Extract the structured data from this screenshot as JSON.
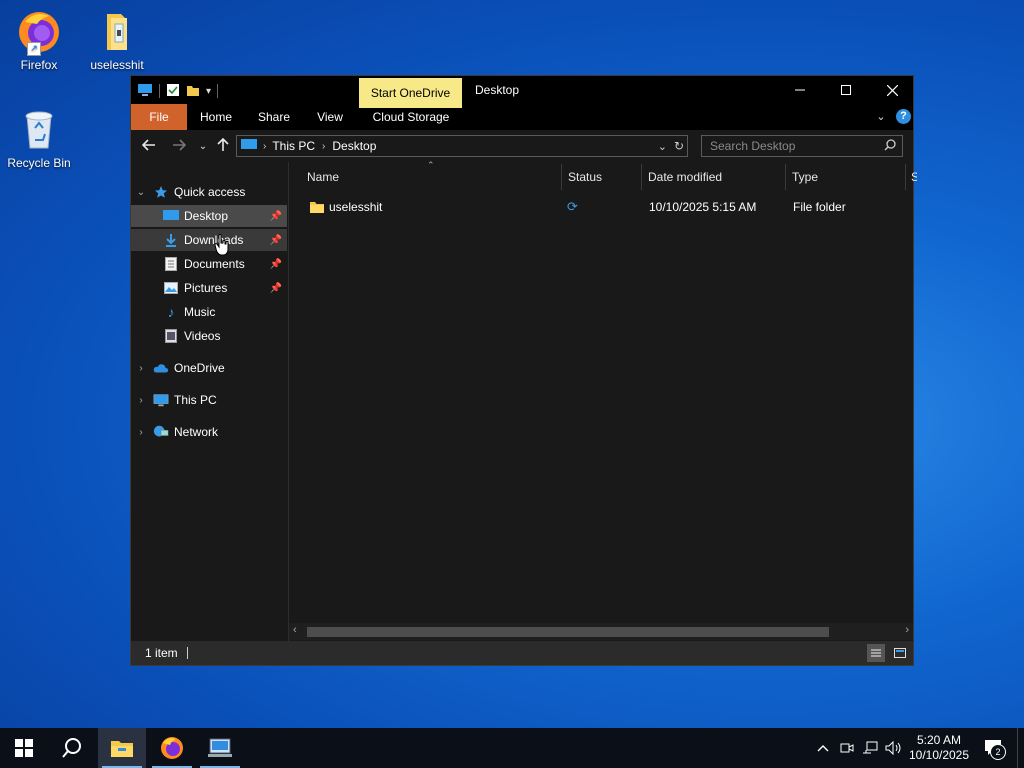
{
  "desktop": {
    "icons": [
      {
        "label": "Firefox",
        "icon": "firefox-icon"
      },
      {
        "label": "uselesshit",
        "icon": "folder-zip-icon"
      },
      {
        "label": "Recycle Bin",
        "icon": "recycle-bin-icon"
      }
    ]
  },
  "window": {
    "title": "Desktop",
    "contextual_tab": "Start OneDrive",
    "ribbon_tabs": [
      "File",
      "Home",
      "Share",
      "View",
      "Cloud Storage"
    ],
    "breadcrumb": [
      "This PC",
      "Desktop"
    ],
    "search_placeholder": "Search Desktop",
    "nav": {
      "quick_access": "Quick access",
      "quick_items": [
        {
          "label": "Desktop",
          "icon": "desktop-icon",
          "pinned": true,
          "selected": true
        },
        {
          "label": "Downloads",
          "icon": "downloads-icon",
          "pinned": true,
          "hover": true
        },
        {
          "label": "Documents",
          "icon": "documents-icon",
          "pinned": true
        },
        {
          "label": "Pictures",
          "icon": "pictures-icon",
          "pinned": true
        },
        {
          "label": "Music",
          "icon": "music-icon",
          "pinned": false
        },
        {
          "label": "Videos",
          "icon": "videos-icon",
          "pinned": false
        }
      ],
      "roots": [
        {
          "label": "OneDrive",
          "icon": "onedrive-icon"
        },
        {
          "label": "This PC",
          "icon": "this-pc-icon"
        },
        {
          "label": "Network",
          "icon": "network-icon"
        }
      ]
    },
    "columns": [
      "Name",
      "Status",
      "Date modified",
      "Type",
      "S"
    ],
    "files": [
      {
        "name": "uselesshit",
        "status": "sync-pending",
        "date_modified": "10/10/2025 5:15 AM",
        "type": "File folder"
      }
    ],
    "status_bar": {
      "item_count": "1 item"
    }
  },
  "taskbar": {
    "apps": [
      "start",
      "search",
      "file-explorer",
      "firefox",
      "network-app"
    ],
    "clock_time": "5:20 AM",
    "clock_date": "10/10/2025",
    "notification_count": "2"
  },
  "colors": {
    "file_tab": "#d0622b",
    "contextual_tab": "#f7e988",
    "accent_blue": "#3a9be6"
  }
}
